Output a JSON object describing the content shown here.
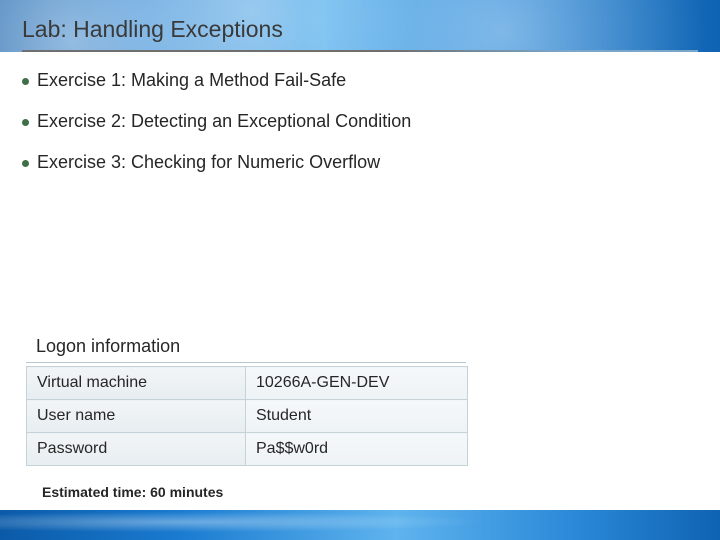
{
  "title": "Lab: Handling Exceptions",
  "bullets": [
    "Exercise 1: Making a Method Fail-Safe",
    "Exercise 2: Detecting an Exceptional Condition",
    "Exercise 3: Checking for Numeric Overflow"
  ],
  "logon": {
    "heading": "Logon information",
    "rows": [
      {
        "key": "Virtual machine",
        "value": "10266A-GEN-DEV"
      },
      {
        "key": "User name",
        "value": "Student"
      },
      {
        "key": "Password",
        "value": "Pa$$w0rd"
      }
    ]
  },
  "estimated": "Estimated time: 60 minutes"
}
